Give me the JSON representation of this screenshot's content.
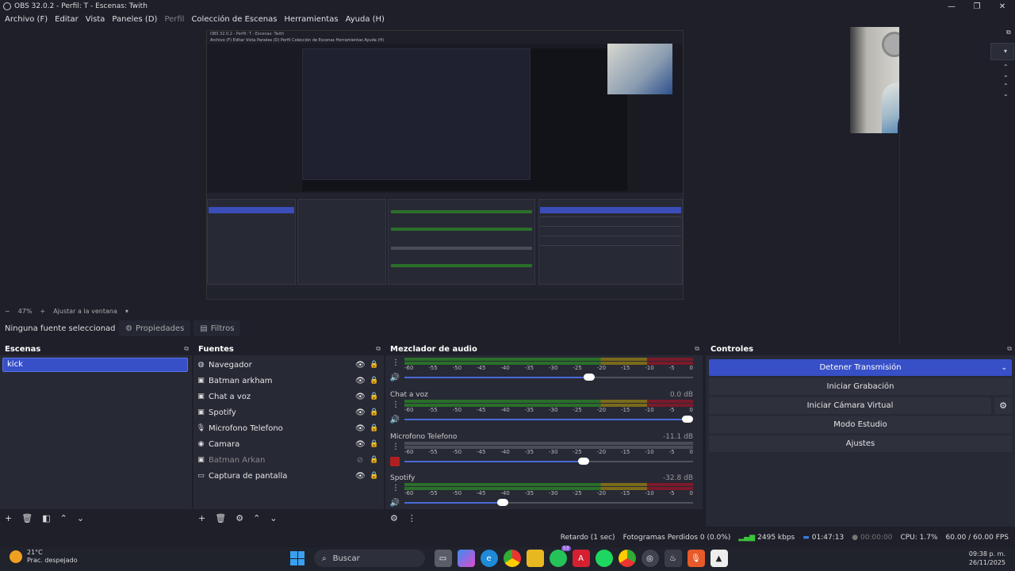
{
  "window": {
    "title": "OBS 32.0.2 - Perfil: T - Escenas: Twith"
  },
  "menu": {
    "items": [
      "Archivo (F)",
      "Editar",
      "Vista",
      "Paneles (D)",
      "Perfil",
      "Colección de Escenas",
      "Herramientas",
      "Ayuda (H)"
    ]
  },
  "nested": {
    "title": "OBS 32.0.2 - Perfil: T - Escenas: Twith",
    "menu": "Archivo (F)  Editar  Vista  Paneles (D)  Perfil  Colección de Escenas  Herramientas  Ayuda (H)"
  },
  "zoom": {
    "minus": "−",
    "value": "47%",
    "plus": "+",
    "fit": "Ajustar a la ventana"
  },
  "source_toolbar": {
    "no_source": "Ninguna fuente seleccionada",
    "properties": "Propiedades",
    "filters": "Filtros"
  },
  "scenes": {
    "title": "Escenas",
    "items": [
      "kick"
    ]
  },
  "sources": {
    "title": "Fuentes",
    "items": [
      {
        "name": "Navegador",
        "icon": "globe-icon",
        "glyph": "◍",
        "visible": true
      },
      {
        "name": "Batman arkham",
        "icon": "window-capture-icon",
        "glyph": "▣",
        "visible": true
      },
      {
        "name": "Chat a voz",
        "icon": "window-capture-icon",
        "glyph": "▣",
        "visible": true
      },
      {
        "name": "Spotify",
        "icon": "window-capture-icon",
        "glyph": "▣",
        "visible": true
      },
      {
        "name": "Microfono Telefono",
        "icon": "microphone-icon",
        "glyph": "🎙",
        "visible": true
      },
      {
        "name": "Camara",
        "icon": "camera-icon",
        "glyph": "◉",
        "visible": true
      },
      {
        "name": "Batman Arkan",
        "icon": "window-capture-icon",
        "glyph": "▣",
        "visible": false
      },
      {
        "name": "Captura de pantalla",
        "icon": "monitor-icon",
        "glyph": "▭",
        "visible": true
      }
    ]
  },
  "mixer": {
    "title": "Mezclador de audio",
    "ticks": [
      "-60",
      "-55",
      "-50",
      "-45",
      "-40",
      "-35",
      "-30",
      "-25",
      "-20",
      "-15",
      "-10",
      "-5",
      "0"
    ],
    "channels": [
      {
        "name": "",
        "db": "",
        "volume": 0.64,
        "muted": false,
        "level": 0.0
      },
      {
        "name": "Chat a voz",
        "db": "0.0 dB",
        "volume": 1.0,
        "muted": false,
        "level": 0.0
      },
      {
        "name": "Microfono Telefono",
        "db": "-11.1 dB",
        "volume": 0.62,
        "muted": true,
        "level": 0.0
      },
      {
        "name": "Spotify",
        "db": "-32.8 dB",
        "volume": 0.34,
        "muted": false,
        "level": 0.0
      }
    ]
  },
  "controls": {
    "title": "Controles",
    "stop_stream": "Detener Transmisión",
    "start_recording": "Iniciar Grabación",
    "virtual_camera": "Iniciar Cámara Virtual",
    "studio_mode": "Modo Estudio",
    "settings": "Ajustes"
  },
  "status": {
    "delay": "Retardo (1 sec)",
    "dropped": "Fotogramas Perdidos 0 (0.0%)",
    "bitrate": "2495 kbps",
    "stream_time": "01:47:13",
    "rec_time": "00:00:00",
    "cpu": "CPU: 1.7%",
    "fps": "60.00 / 60.00 FPS"
  },
  "taskbar": {
    "temp": "21°C",
    "weather": "Prac. despejado",
    "search": "Buscar",
    "whatsapp_badge": "53",
    "time": "09:38 p. m.",
    "date": "26/11/2025"
  },
  "colors": {
    "accent": "#3750c8",
    "background": "#1e1f29",
    "dock": "#272935",
    "meter_green": "#2a6f2a",
    "meter_yellow": "#7a6a1a",
    "meter_red": "#7a1a2a",
    "muted": "#b02020"
  }
}
